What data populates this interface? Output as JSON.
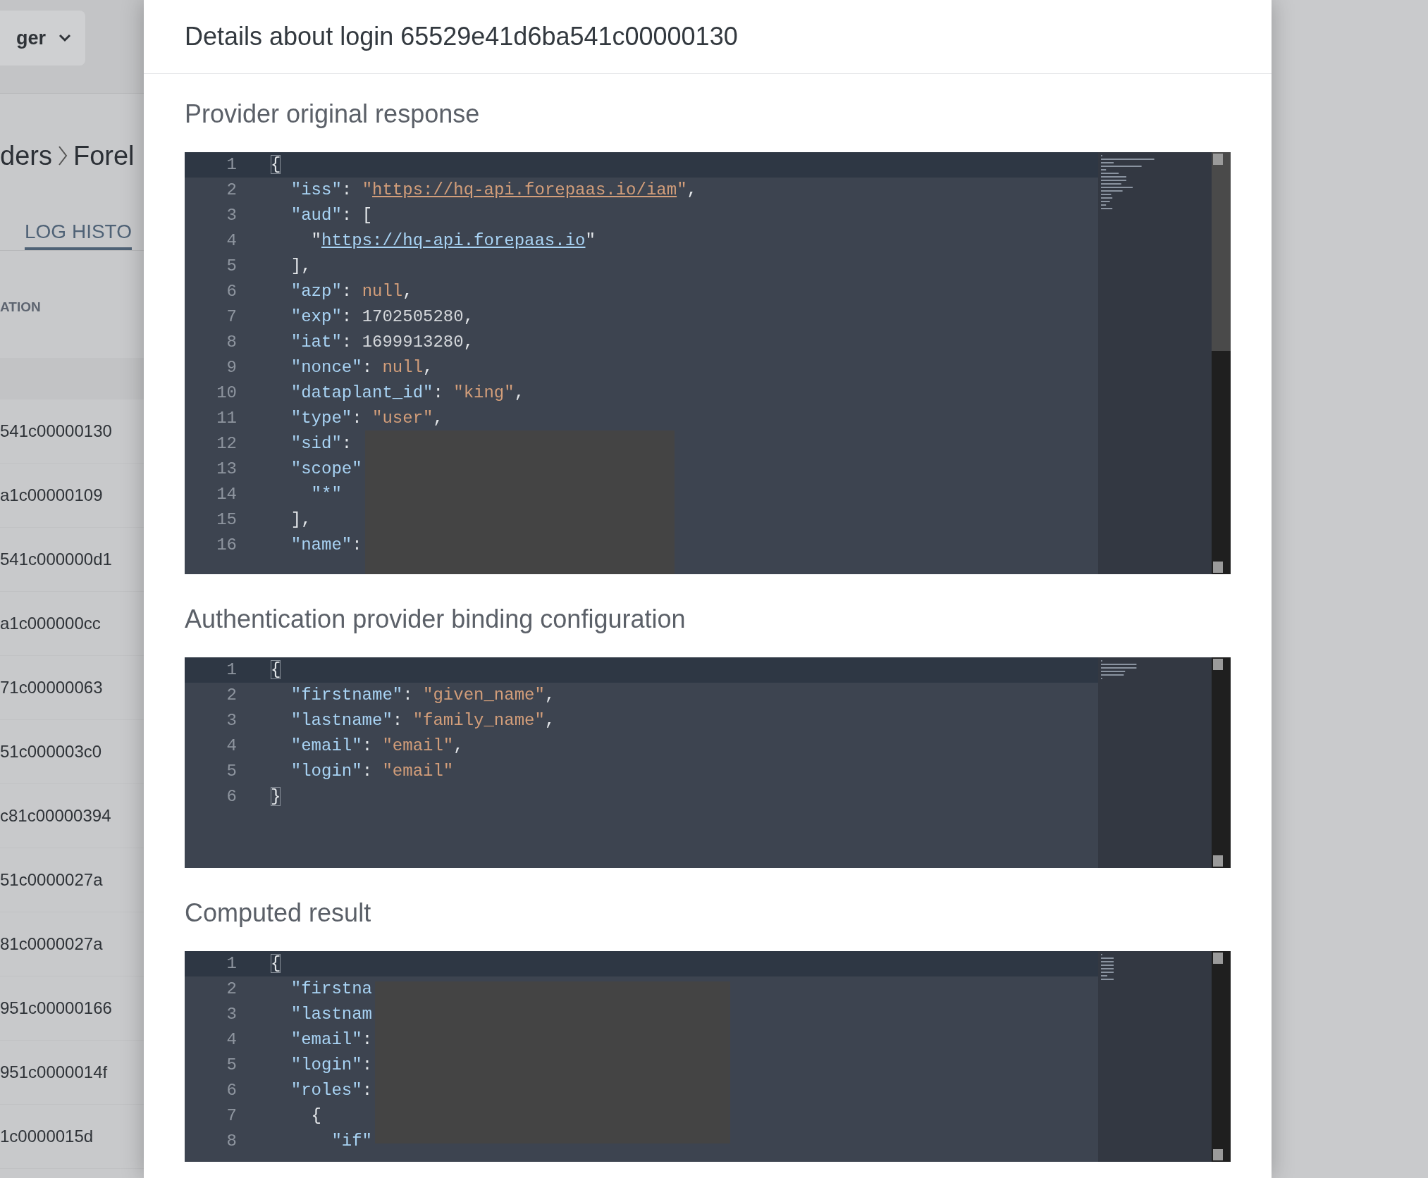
{
  "background": {
    "dropdown": {
      "value": "ger"
    },
    "breadcrumb": [
      "ders",
      "Forel"
    ],
    "tab": {
      "label": "LOG HISTO",
      "selected": true
    },
    "column": "ATION",
    "rows": [
      "541c00000130",
      "a1c00000109",
      "541c000000d1",
      "a1c000000cc",
      "71c00000063",
      "51c000003c0",
      "c81c00000394",
      "51c0000027a",
      "81c0000027a",
      "951c00000166",
      "951c0000014f",
      "1c0000015d"
    ]
  },
  "modal": {
    "title": "Details about login 65529e41d6ba541c00000130",
    "sections": [
      {
        "heading": "Provider original response",
        "redacted": true,
        "lines": [
          {
            "number": "1",
            "active": true,
            "tokens": [
              {
                "kind": "bracket_match",
                "text": "{"
              }
            ]
          },
          {
            "number": "2",
            "active": false,
            "tokens": [
              {
                "kind": "key",
                "text": "  \"iss\""
              },
              {
                "kind": "punct",
                "text": ": "
              },
              {
                "kind": "string",
                "text": "\""
              },
              {
                "kind": "string_link",
                "text": "https://hq-api.forepaas.io/iam"
              },
              {
                "kind": "string",
                "text": "\""
              },
              {
                "kind": "punct",
                "text": ","
              }
            ]
          },
          {
            "number": "3",
            "active": false,
            "tokens": [
              {
                "kind": "key",
                "text": "  \"aud\""
              },
              {
                "kind": "punct",
                "text": ": ["
              }
            ]
          },
          {
            "number": "4",
            "active": false,
            "tokens": [
              {
                "kind": "punct",
                "text": "    \""
              },
              {
                "kind": "key_link",
                "text": "https://hq-api.forepaas.io"
              },
              {
                "kind": "punct",
                "text": "\""
              }
            ]
          },
          {
            "number": "5",
            "active": false,
            "tokens": [
              {
                "kind": "punct",
                "text": "  ],"
              }
            ]
          },
          {
            "number": "6",
            "active": false,
            "tokens": [
              {
                "kind": "key",
                "text": "  \"azp\""
              },
              {
                "kind": "punct",
                "text": ": "
              },
              {
                "kind": "string",
                "text": "null"
              },
              {
                "kind": "punct",
                "text": ","
              }
            ]
          },
          {
            "number": "7",
            "active": false,
            "tokens": [
              {
                "kind": "key",
                "text": "  \"exp\""
              },
              {
                "kind": "punct",
                "text": ": "
              },
              {
                "kind": "number",
                "text": "1702505280"
              },
              {
                "kind": "punct",
                "text": ","
              }
            ]
          },
          {
            "number": "8",
            "active": false,
            "tokens": [
              {
                "kind": "key",
                "text": "  \"iat\""
              },
              {
                "kind": "punct",
                "text": ": "
              },
              {
                "kind": "number",
                "text": "1699913280"
              },
              {
                "kind": "punct",
                "text": ","
              }
            ]
          },
          {
            "number": "9",
            "active": false,
            "tokens": [
              {
                "kind": "key",
                "text": "  \"nonce\""
              },
              {
                "kind": "punct",
                "text": ": "
              },
              {
                "kind": "string",
                "text": "null"
              },
              {
                "kind": "punct",
                "text": ","
              }
            ]
          },
          {
            "number": "10",
            "active": false,
            "tokens": [
              {
                "kind": "key",
                "text": "  \"dataplant_id\""
              },
              {
                "kind": "punct",
                "text": ": "
              },
              {
                "kind": "string",
                "text": "\"king\""
              },
              {
                "kind": "punct",
                "text": ","
              }
            ]
          },
          {
            "number": "11",
            "active": false,
            "tokens": [
              {
                "kind": "key",
                "text": "  \"type\""
              },
              {
                "kind": "punct",
                "text": ": "
              },
              {
                "kind": "string",
                "text": "\"user\""
              },
              {
                "kind": "punct",
                "text": ","
              }
            ]
          },
          {
            "number": "12",
            "active": false,
            "tokens": [
              {
                "kind": "key",
                "text": "  \"sid\""
              },
              {
                "kind": "punct",
                "text": ":"
              }
            ]
          },
          {
            "number": "13",
            "active": false,
            "tokens": [
              {
                "kind": "key",
                "text": "  \"scope\""
              }
            ]
          },
          {
            "number": "14",
            "active": false,
            "tokens": [
              {
                "kind": "key",
                "text": "    \"*\""
              }
            ]
          },
          {
            "number": "15",
            "active": false,
            "tokens": [
              {
                "kind": "punct",
                "text": "  ],"
              }
            ]
          },
          {
            "number": "16",
            "active": false,
            "tokens": [
              {
                "kind": "key",
                "text": "  \"name\""
              },
              {
                "kind": "punct",
                "text": ":"
              }
            ]
          }
        ]
      },
      {
        "heading": "Authentication provider binding configuration",
        "redacted": false,
        "lines": [
          {
            "number": "1",
            "active": true,
            "tokens": [
              {
                "kind": "bracket_match",
                "text": "{"
              }
            ]
          },
          {
            "number": "2",
            "active": false,
            "tokens": [
              {
                "kind": "key",
                "text": "  \"firstname\""
              },
              {
                "kind": "punct",
                "text": ": "
              },
              {
                "kind": "string",
                "text": "\"given_name\""
              },
              {
                "kind": "punct",
                "text": ","
              }
            ]
          },
          {
            "number": "3",
            "active": false,
            "tokens": [
              {
                "kind": "key",
                "text": "  \"lastname\""
              },
              {
                "kind": "punct",
                "text": ": "
              },
              {
                "kind": "string",
                "text": "\"family_name\""
              },
              {
                "kind": "punct",
                "text": ","
              }
            ]
          },
          {
            "number": "4",
            "active": false,
            "tokens": [
              {
                "kind": "key",
                "text": "  \"email\""
              },
              {
                "kind": "punct",
                "text": ": "
              },
              {
                "kind": "string",
                "text": "\"email\""
              },
              {
                "kind": "punct",
                "text": ","
              }
            ]
          },
          {
            "number": "5",
            "active": false,
            "tokens": [
              {
                "kind": "key",
                "text": "  \"login\""
              },
              {
                "kind": "punct",
                "text": ": "
              },
              {
                "kind": "string",
                "text": "\"email\""
              }
            ]
          },
          {
            "number": "6",
            "active": false,
            "tokens": [
              {
                "kind": "bracket_match",
                "text": "}"
              }
            ]
          }
        ]
      },
      {
        "heading": "Computed result",
        "redacted": true,
        "lines": [
          {
            "number": "1",
            "active": true,
            "tokens": [
              {
                "kind": "bracket_match",
                "text": "{"
              }
            ]
          },
          {
            "number": "2",
            "active": false,
            "tokens": [
              {
                "kind": "key",
                "text": "  \"firstna"
              }
            ]
          },
          {
            "number": "3",
            "active": false,
            "tokens": [
              {
                "kind": "key",
                "text": "  \"lastnam"
              }
            ]
          },
          {
            "number": "4",
            "active": false,
            "tokens": [
              {
                "kind": "key",
                "text": "  \"email\""
              },
              {
                "kind": "punct",
                "text": ":"
              }
            ]
          },
          {
            "number": "5",
            "active": false,
            "tokens": [
              {
                "kind": "key",
                "text": "  \"login\""
              },
              {
                "kind": "punct",
                "text": ":"
              }
            ]
          },
          {
            "number": "6",
            "active": false,
            "tokens": [
              {
                "kind": "key",
                "text": "  \"roles\""
              },
              {
                "kind": "punct",
                "text": ":"
              }
            ]
          },
          {
            "number": "7",
            "active": false,
            "tokens": [
              {
                "kind": "punct",
                "text": "    {"
              }
            ]
          },
          {
            "number": "8",
            "active": false,
            "tokens": [
              {
                "kind": "key",
                "text": "      \"if\""
              }
            ]
          }
        ]
      }
    ]
  }
}
